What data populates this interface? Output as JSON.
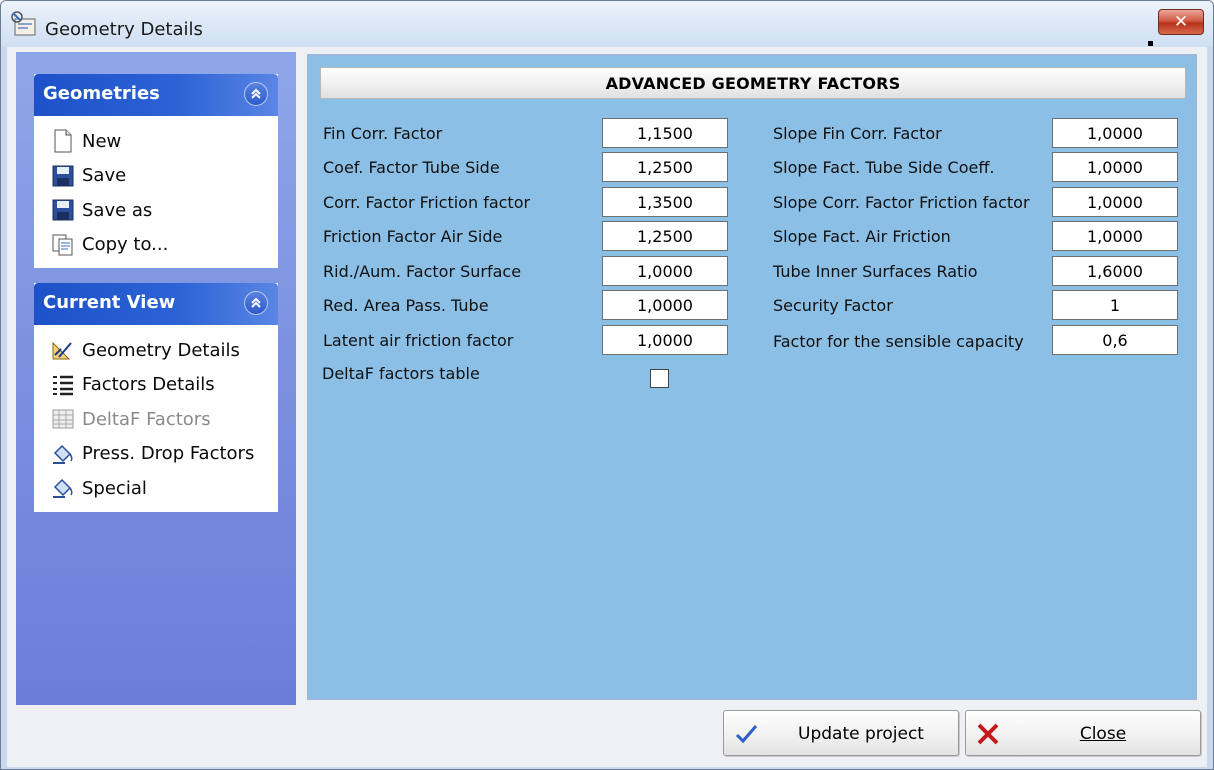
{
  "window": {
    "title": "Geometry Details",
    "close_glyph": "✕"
  },
  "sidebar": {
    "groups": [
      {
        "title": "Geometries",
        "items": [
          {
            "label": "New",
            "icon": "new-document-icon"
          },
          {
            "label": "Save",
            "icon": "floppy-disk-icon"
          },
          {
            "label": "Save as",
            "icon": "floppy-disk-icon"
          },
          {
            "label": "Copy to...",
            "icon": "copy-icon"
          }
        ]
      },
      {
        "title": "Current View",
        "items": [
          {
            "label": "Geometry Details",
            "icon": "ruler-square-icon"
          },
          {
            "label": "Factors Details",
            "icon": "numbered-list-icon"
          },
          {
            "label": "DeltaF Factors",
            "icon": "table-grid-icon",
            "disabled": true
          },
          {
            "label": "Press. Drop Factors",
            "icon": "paint-bucket-icon"
          },
          {
            "label": "Special",
            "icon": "paint-bucket-icon"
          }
        ]
      }
    ]
  },
  "main": {
    "header": "ADVANCED GEOMETRY FACTORS",
    "left_fields": [
      {
        "label": "Fin Corr. Factor",
        "value": "1,1500"
      },
      {
        "label": "Coef. Factor Tube Side",
        "value": "1,2500"
      },
      {
        "label": "Corr. Factor Friction factor",
        "value": "1,3500"
      },
      {
        "label": "Friction Factor Air Side",
        "value": "1,2500"
      },
      {
        "label": "Rid./Aum. Factor Surface",
        "value": "1,0000"
      },
      {
        "label": "Red. Area Pass. Tube",
        "value": "1,0000"
      },
      {
        "label": "Latent air friction factor",
        "value": "1,0000"
      }
    ],
    "right_fields": [
      {
        "label": "Slope Fin Corr. Factor",
        "value": "1,0000"
      },
      {
        "label": "Slope Fact. Tube Side Coeff.",
        "value": "1,0000"
      },
      {
        "label": "Slope Corr. Factor Friction factor",
        "value": "1,0000"
      },
      {
        "label": "Slope Fact.  Air Friction",
        "value": "1,0000"
      },
      {
        "label": "Tube Inner Surfaces Ratio",
        "value": "1,6000"
      },
      {
        "label": "Security Factor",
        "value": "1"
      },
      {
        "label": "Factor for the sensible capacity",
        "value": "0,6"
      }
    ],
    "deltaf_label": "DeltaF factors table",
    "deltaf_checked": false
  },
  "footer": {
    "update_label": "Update project",
    "close_label": "Close"
  },
  "colors": {
    "content_bg": "#8bbfe6",
    "pane_bg": "#7a90e0",
    "group_header": "#2d63d6"
  }
}
